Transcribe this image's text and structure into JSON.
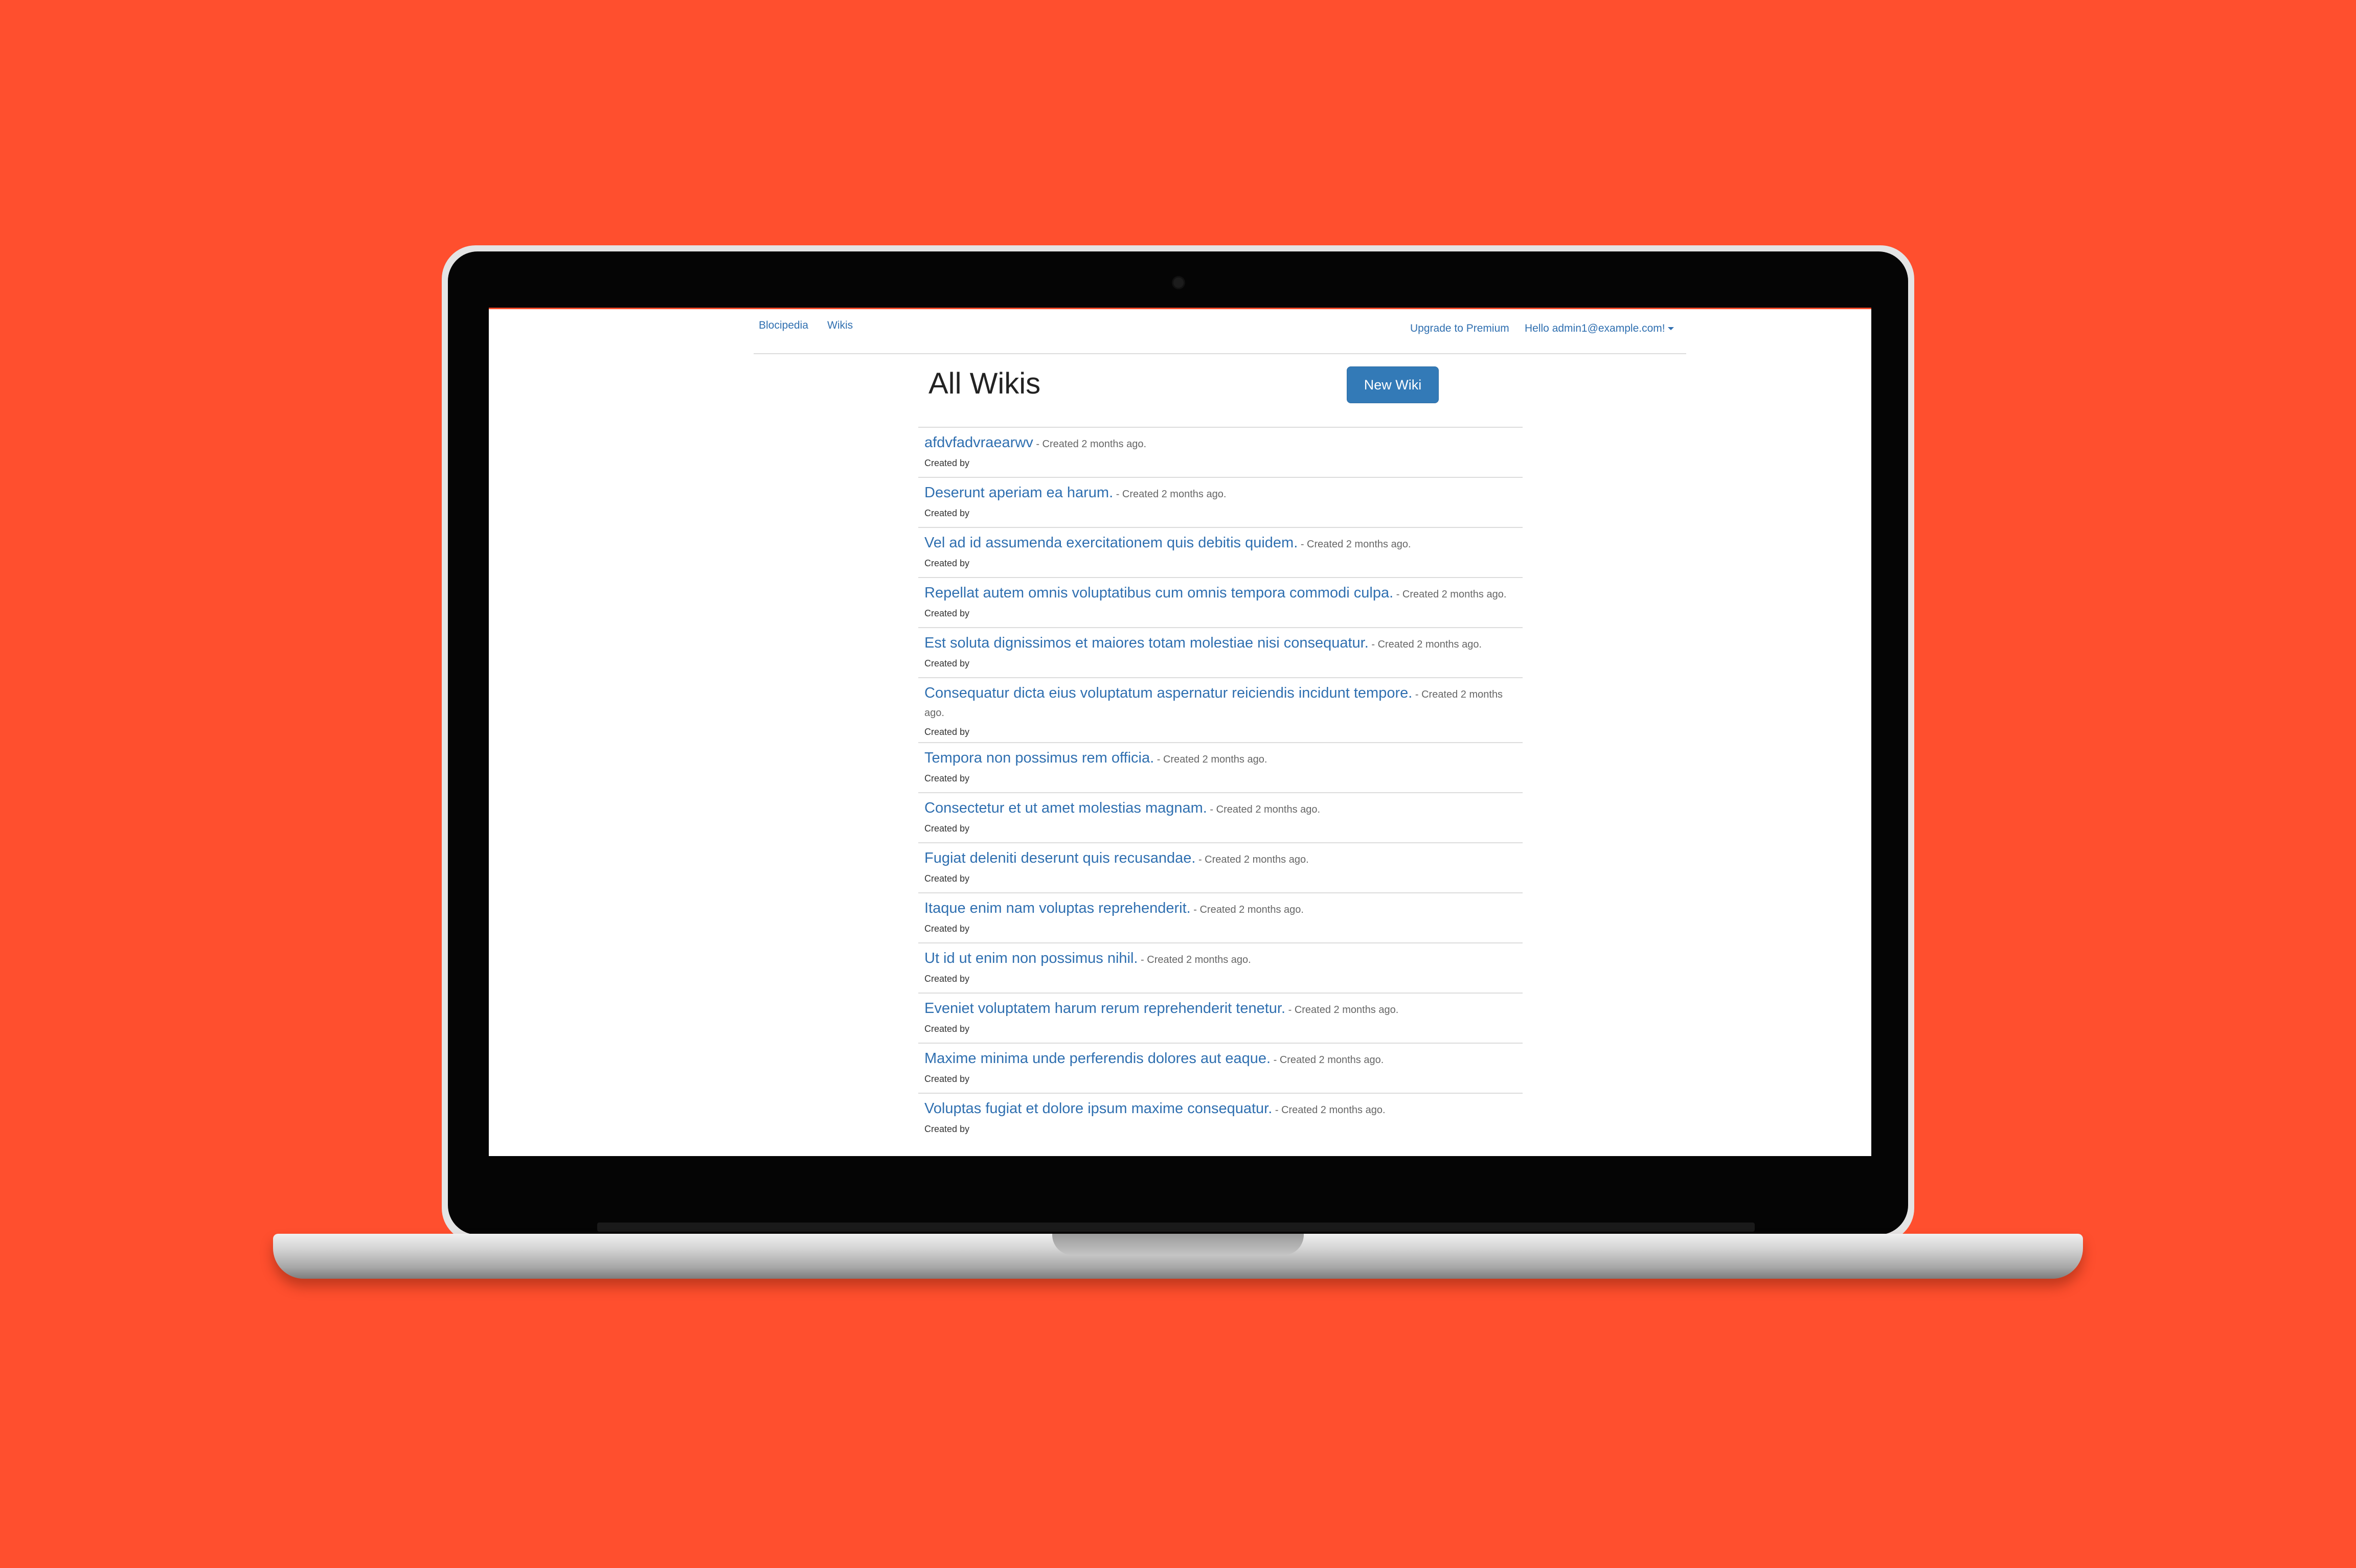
{
  "nav": {
    "brand": "Blocipedia",
    "wikis": "Wikis",
    "upgrade": "Upgrade to Premium",
    "user": "Hello admin1@example.com!"
  },
  "page": {
    "title": "All Wikis",
    "new_button": "New Wiki"
  },
  "wikis": [
    {
      "title": "afdvfadvraearwv",
      "meta": " - Created 2 months ago.",
      "by": "Created by"
    },
    {
      "title": "Deserunt aperiam ea harum.",
      "meta": " - Created 2 months ago.",
      "by": "Created by"
    },
    {
      "title": "Vel ad id assumenda exercitationem quis debitis quidem.",
      "meta": " - Created 2 months ago.",
      "by": "Created by"
    },
    {
      "title": "Repellat autem omnis voluptatibus cum omnis tempora commodi culpa.",
      "meta": " - Created 2 months ago.",
      "by": "Created by"
    },
    {
      "title": "Est soluta dignissimos et maiores totam molestiae nisi consequatur.",
      "meta": " - Created 2 months ago.",
      "by": "Created by"
    },
    {
      "title": "Consequatur dicta eius voluptatum aspernatur reiciendis incidunt tempore.",
      "meta": " - Created 2 months ago.",
      "by": "Created by"
    },
    {
      "title": "Tempora non possimus rem officia.",
      "meta": " - Created 2 months ago.",
      "by": "Created by"
    },
    {
      "title": "Consectetur et ut amet molestias magnam.",
      "meta": " - Created 2 months ago.",
      "by": "Created by"
    },
    {
      "title": "Fugiat deleniti deserunt quis recusandae.",
      "meta": " - Created 2 months ago.",
      "by": "Created by"
    },
    {
      "title": "Itaque enim nam voluptas reprehenderit.",
      "meta": " - Created 2 months ago.",
      "by": "Created by"
    },
    {
      "title": "Ut id ut enim non possimus nihil.",
      "meta": " - Created 2 months ago.",
      "by": "Created by"
    },
    {
      "title": "Eveniet voluptatem harum rerum reprehenderit tenetur.",
      "meta": " - Created 2 months ago.",
      "by": "Created by"
    },
    {
      "title": "Maxime minima unde perferendis dolores aut eaque.",
      "meta": " - Created 2 months ago.",
      "by": "Created by"
    },
    {
      "title": "Voluptas fugiat et dolore ipsum maxime consequatur.",
      "meta": " - Created 2 months ago.",
      "by": "Created by"
    }
  ],
  "colors": {
    "background": "#ff4f2e",
    "link": "#2f6fb0",
    "button": "#337ab7"
  }
}
